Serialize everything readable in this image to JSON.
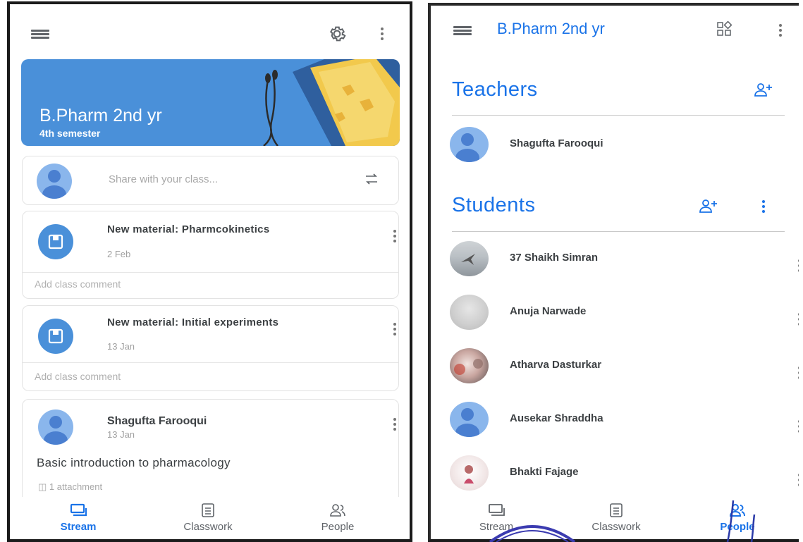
{
  "stream_screen": {
    "class_banner": {
      "title": "B.Pharm 2nd yr",
      "subtitle": "4th semester"
    },
    "share_placeholder": "Share with your class...",
    "posts": [
      {
        "title": "New material: Pharmcokinetics",
        "date": "2 Feb",
        "comment_placeholder": "Add class comment"
      },
      {
        "title": "New material: Initial experiments",
        "date": "13 Jan",
        "comment_placeholder": "Add class comment"
      }
    ],
    "announcement": {
      "author": "Shagufta Farooqui",
      "date": "13 Jan",
      "body": "Basic introduction to pharmacology",
      "attachments": "1 attachment"
    },
    "nav": {
      "stream": "Stream",
      "classwork": "Classwork",
      "people": "People",
      "active": "stream"
    }
  },
  "people_screen": {
    "title": "B.Pharm 2nd yr",
    "teachers_heading": "Teachers",
    "teachers": [
      "Shagufta Farooqui"
    ],
    "students_heading": "Students",
    "students": [
      "37 Shaikh Simran",
      "Anuja Narwade",
      "Atharva Dasturkar",
      "Ausekar Shraddha",
      "Bhakti Fajage"
    ],
    "nav": {
      "stream": "Stream",
      "classwork": "Classwork",
      "people": "People",
      "active": "people"
    }
  },
  "colors": {
    "accent": "#1a73e8",
    "banner": "#4a90d9",
    "avatar": "#8ab6ec"
  },
  "icons": [
    "menu-icon",
    "gear-icon",
    "more-vert-icon",
    "repost-icon",
    "material-icon",
    "attachment-icon",
    "stream-icon",
    "classwork-icon",
    "people-icon",
    "add-person-icon",
    "class-grid-icon"
  ]
}
